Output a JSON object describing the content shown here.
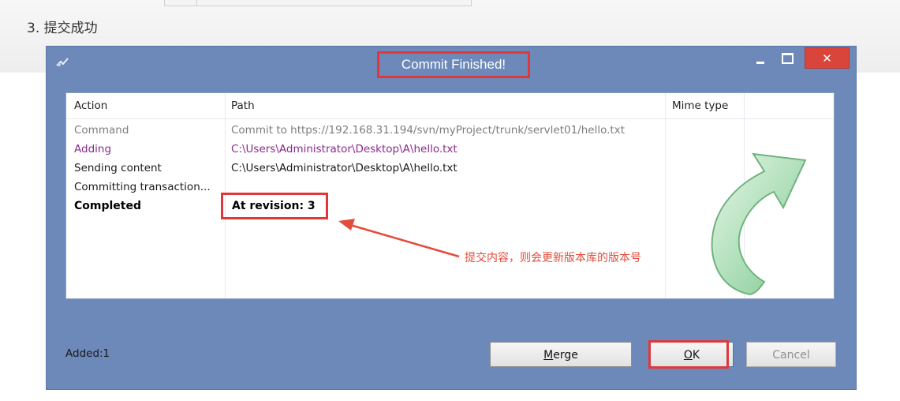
{
  "step_heading": "3. 提交成功",
  "dialog": {
    "title": "Commit Finished!",
    "close_glyph": "✕",
    "columns": {
      "action": "Action",
      "path": "Path",
      "mime": "Mime type"
    },
    "rows": [
      {
        "action": "Command",
        "path": "Commit to https://192.168.31.194/svn/myProject/trunk/servlet01/hello.txt"
      },
      {
        "action": "Adding",
        "path": "C:\\Users\\Administrator\\Desktop\\A\\hello.txt"
      },
      {
        "action": "Sending content",
        "path": "C:\\Users\\Administrator\\Desktop\\A\\hello.txt"
      },
      {
        "action": "Committing transaction...",
        "path": ""
      },
      {
        "action": "Completed",
        "path": "At revision: 3"
      }
    ],
    "annotation": "提交内容，则会更新版本库的版本号",
    "status": "Added:1",
    "buttons": {
      "merge_underlined": "M",
      "merge_rest": "erge",
      "ok_underlined": "O",
      "ok_rest": "K",
      "cancel": "Cancel"
    }
  },
  "colors": {
    "dialog_bg": "#6c89b9",
    "highlight_red": "#e0383a",
    "adding_purple": "#8b2a8b",
    "close_red": "#d9453b",
    "arrow_green": "#9fd9a8"
  },
  "icons": [
    "app-icon",
    "minimize-icon",
    "maximize-icon",
    "close-icon",
    "red-arrow-icon",
    "green-curved-arrow-icon"
  ]
}
